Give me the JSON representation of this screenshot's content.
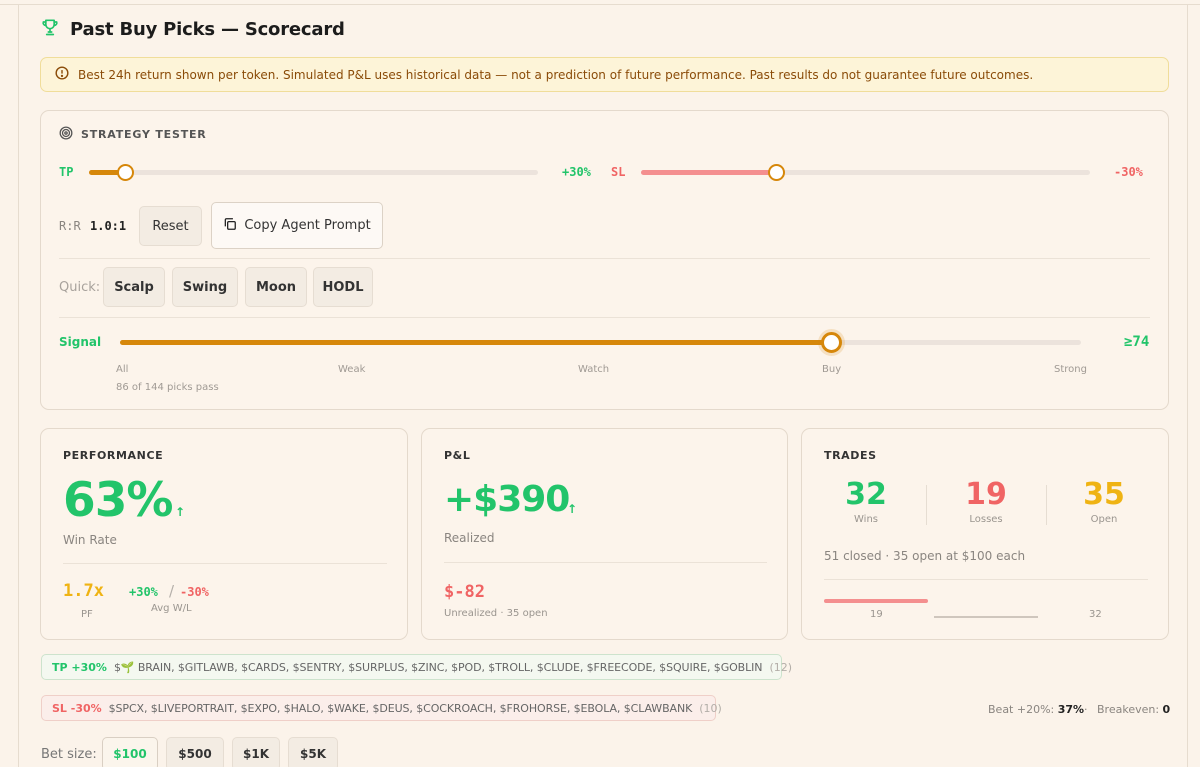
{
  "header": {
    "title": "Past Buy Picks — Scorecard",
    "icon": "trophy-icon"
  },
  "warning": {
    "icon": "alert-circle-icon",
    "text": "Best 24h return shown per token. Simulated P&L uses historical data — not a prediction of future performance. Past results do not guarantee future outcomes."
  },
  "strategy": {
    "title": "STRATEGY TESTER",
    "tp": {
      "label": "TP",
      "value": "+30%",
      "level": 0.08
    },
    "sl": {
      "label": "SL",
      "value": "-30%",
      "level": 0.3
    },
    "rr": {
      "label": "R:R",
      "value": "1.0:1"
    },
    "reset_label": "Reset",
    "copy_label": "Copy Agent Prompt",
    "quick": {
      "label": "Quick:",
      "items": [
        "Scalp",
        "Swing",
        "Moon",
        "HODL"
      ]
    },
    "signal": {
      "label": "Signal",
      "value": "≥74",
      "level": 0.74,
      "ticks": [
        "All",
        "Weak",
        "Watch",
        "Buy",
        "Strong"
      ],
      "pass_text": "86 of 144 picks pass"
    }
  },
  "performance": {
    "title": "PERFORMANCE",
    "win_rate": "63%",
    "win_rate_label": "Win Rate",
    "pf_value": "1.7x",
    "pf_label": "PF",
    "avg_win": "+30%",
    "avg_sep": "/",
    "avg_loss": "-30%",
    "avg_label": "Avg W/L"
  },
  "pnl": {
    "title": "P&L",
    "realized": "+$390",
    "realized_label": "Realized",
    "unrealized": "$-82",
    "unrealized_label": "Unrealized · 35 open"
  },
  "trades": {
    "title": "TRADES",
    "wins": "32",
    "wins_label": "Wins",
    "losses": "19",
    "losses_label": "Losses",
    "open": "35",
    "open_label": "Open",
    "summary": "51 closed · 35 open at $100 each",
    "bar_left": "19",
    "bar_right": "32"
  },
  "tp_list": {
    "tag": "TP +30%",
    "names": "$🌱 BRAIN, $GITLAWB, $CARDS, $SENTRY, $SURPLUS, $ZINC, $POD, $TROLL, $CLUDE, $FREECODE, $SQUIRE, $GOBLIN",
    "count": "(12)"
  },
  "sl_list": {
    "tag": "SL -30%",
    "names": "$SPCX, $LIVEPORTRAIT, $EXPO, $HALO, $WAKE, $DEUS, $COCKROACH, $FROHORSE, $EBOLA, $CLAWBANK",
    "count": "(10)"
  },
  "stats": {
    "beat_label": "Beat +20%:",
    "beat_value": "37%",
    "sep": "·",
    "breakeven_label": "Breakeven:",
    "breakeven_value": "0"
  },
  "bet": {
    "label": "Bet size:",
    "options": [
      "$100",
      "$500",
      "$1K",
      "$5K"
    ],
    "selected": "$100"
  },
  "colors": {
    "green": "#22c46a",
    "red": "#f06464",
    "amber": "#efb313",
    "accent": "#d6870a"
  }
}
